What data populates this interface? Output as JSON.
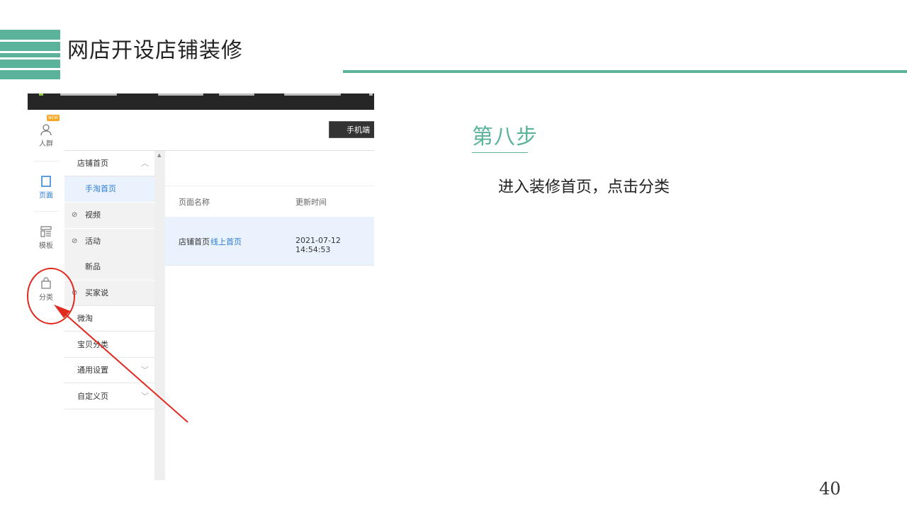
{
  "slide": {
    "title": "网店开设店铺装修",
    "step_title": "第八步",
    "step_description": "进入装修首页，点击分类",
    "page_number": "40",
    "accent_color": "#5bb39c",
    "annotation_color": "#e02a1f"
  },
  "screenshot": {
    "rail": {
      "badge": "NEW",
      "items": [
        {
          "label": "人群",
          "icon": "person-icon"
        },
        {
          "label": "页面",
          "icon": "page-icon"
        },
        {
          "label": "模板",
          "icon": "template-icon"
        },
        {
          "label": "分类",
          "icon": "bag-icon"
        }
      ],
      "help": "?"
    },
    "toolbar": {
      "mobile_button": "手机端"
    },
    "nav": [
      {
        "label": "店铺首页"
      },
      {
        "label": "手淘首页"
      },
      {
        "label": "视频"
      },
      {
        "label": "活动"
      },
      {
        "label": "新品"
      },
      {
        "label": "买家说"
      },
      {
        "label": "微淘"
      },
      {
        "label": "宝贝分类"
      },
      {
        "label": "通用设置"
      },
      {
        "label": "自定义页"
      }
    ],
    "table": {
      "headers": [
        "页面名称",
        "更新时间"
      ],
      "rows": [
        {
          "name": "店铺首页",
          "tag": "线上首页",
          "updated": "2021-07-12 14:54:53"
        }
      ]
    }
  }
}
